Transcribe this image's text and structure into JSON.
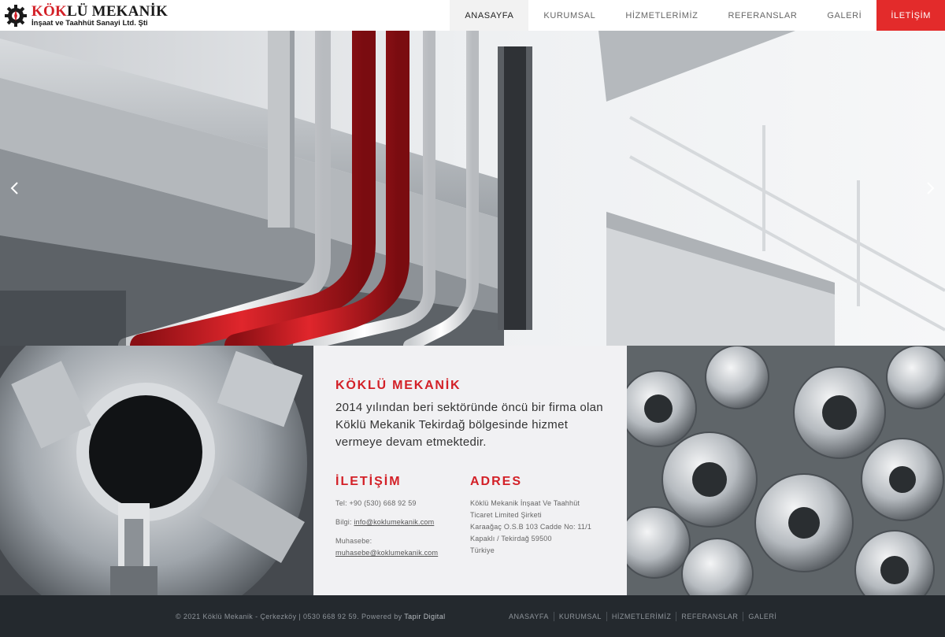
{
  "brand": {
    "name_red": "KÖK",
    "name_dark": "LÜ MEKANİK",
    "subtitle": "İnşaat ve Taahhüt Sanayi Ltd. Şti"
  },
  "nav": {
    "items": [
      "ANASAYFA",
      "KURUMSAL",
      "HİZMETLERİMİZ",
      "REFERANSLAR",
      "GALERİ"
    ],
    "cta": "İLETİŞİM",
    "active_index": 0
  },
  "about": {
    "title": "KÖKLÜ MEKANİK",
    "description": "2014 yılından beri sektöründe öncü bir firma olan Köklü Mekanik Tekirdağ bölgesinde hizmet vermeye devam etmektedir."
  },
  "contact": {
    "title": "İLETİŞİM",
    "phone": "Tel: +90 (530) 668 92 59",
    "info_label": "Bilgi:",
    "info_email": "info@koklumekanik.com",
    "accounting_label": "Muhasebe:",
    "accounting_email": "muhasebe@koklumekanik.com"
  },
  "address": {
    "title": "ADRES",
    "lines": [
      "Köklü Mekanik İnşaat Ve Taahhüt",
      "Ticaret Limited Şirketi",
      "Karaağaç O.S.B 103 Cadde No: 11/1",
      "Kapaklı / Tekirdağ 59500",
      "Türkiye"
    ]
  },
  "footer": {
    "copyright": "© 2021 Köklü Mekanik - Çerkezköy | 0530 668 92 59. Powered by",
    "powered_by": "Tapir Digital",
    "links": [
      "ANASAYFA",
      "KURUMSAL",
      "HİZMETLERİMİZ",
      "REFERANSLAR",
      "GALERİ"
    ]
  },
  "colors": {
    "accent": "#d32027",
    "cta": "#e32b2b",
    "footer_bg": "#24292e",
    "panel_bg": "#f1f1f3"
  },
  "icons": {
    "logo": "gear-logo-icon",
    "slider_prev": "chevron-left-icon",
    "slider_next": "chevron-right-icon"
  }
}
